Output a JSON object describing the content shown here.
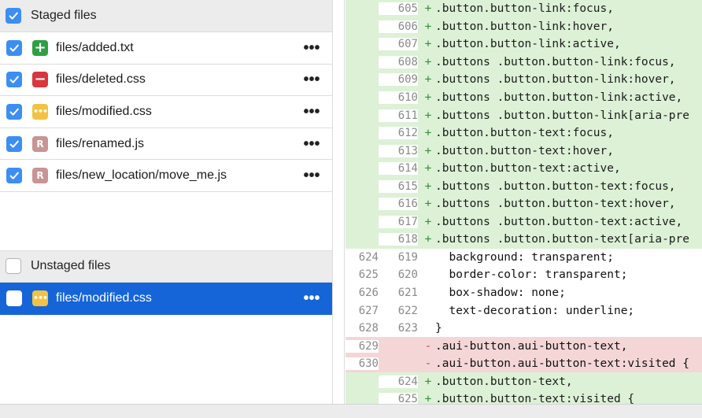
{
  "staged": {
    "header": "Staged files",
    "files": [
      {
        "name": "files/added.txt",
        "status": "added",
        "status_glyph": "+",
        "more": "•••"
      },
      {
        "name": "files/deleted.css",
        "status": "deleted",
        "status_glyph": "−",
        "more": "•••"
      },
      {
        "name": "files/modified.css",
        "status": "modified",
        "status_glyph": "•••",
        "more": "•••"
      },
      {
        "name": "files/renamed.js",
        "status": "renamed",
        "status_glyph": "R",
        "more": "•••"
      },
      {
        "name": "files/new_location/move_me.js",
        "status": "renamed",
        "status_glyph": "R",
        "more": "•••"
      }
    ]
  },
  "unstaged": {
    "header": "Unstaged files",
    "files": [
      {
        "name": "files/modified.css",
        "status": "modified",
        "status_glyph": "•••",
        "more": "•••",
        "selected": true
      }
    ]
  },
  "colors": {
    "selection": "#1565d8",
    "checkbox": "#3d8ef2",
    "added_bg": "#dcf1d6",
    "removed_bg": "#f4d6d6",
    "added_status": "#2ea043",
    "deleted_status": "#d9363e",
    "modified_status": "#f2c342",
    "renamed_status": "#c99494"
  },
  "diff": [
    {
      "old": "",
      "new": "605",
      "type": "added",
      "sign": "+",
      "code": ".button.button-link:focus,"
    },
    {
      "old": "",
      "new": "606",
      "type": "added",
      "sign": "+",
      "code": ".button.button-link:hover,"
    },
    {
      "old": "",
      "new": "607",
      "type": "added",
      "sign": "+",
      "code": ".button.button-link:active,"
    },
    {
      "old": "",
      "new": "608",
      "type": "added",
      "sign": "+",
      "code": ".buttons .button.button-link:focus,"
    },
    {
      "old": "",
      "new": "609",
      "type": "added",
      "sign": "+",
      "code": ".buttons .button.button-link:hover,"
    },
    {
      "old": "",
      "new": "610",
      "type": "added",
      "sign": "+",
      "code": ".buttons .button.button-link:active,"
    },
    {
      "old": "",
      "new": "611",
      "type": "added",
      "sign": "+",
      "code": ".buttons .button.button-link[aria-pre"
    },
    {
      "old": "",
      "new": "612",
      "type": "added",
      "sign": "+",
      "code": ".button.button-text:focus,"
    },
    {
      "old": "",
      "new": "613",
      "type": "added",
      "sign": "+",
      "code": ".button.button-text:hover,"
    },
    {
      "old": "",
      "new": "614",
      "type": "added",
      "sign": "+",
      "code": ".button.button-text:active,"
    },
    {
      "old": "",
      "new": "615",
      "type": "added",
      "sign": "+",
      "code": ".buttons .button.button-text:focus,"
    },
    {
      "old": "",
      "new": "616",
      "type": "added",
      "sign": "+",
      "code": ".buttons .button.button-text:hover,"
    },
    {
      "old": "",
      "new": "617",
      "type": "added",
      "sign": "+",
      "code": ".buttons .button.button-text:active,"
    },
    {
      "old": "",
      "new": "618",
      "type": "added",
      "sign": "+",
      "code": ".buttons .button.button-text[aria-pre"
    },
    {
      "old": "624",
      "new": "619",
      "type": "context",
      "sign": "",
      "code": "  background: transparent;"
    },
    {
      "old": "625",
      "new": "620",
      "type": "context",
      "sign": "",
      "code": "  border-color: transparent;"
    },
    {
      "old": "626",
      "new": "621",
      "type": "context",
      "sign": "",
      "code": "  box-shadow: none;"
    },
    {
      "old": "627",
      "new": "622",
      "type": "context",
      "sign": "",
      "code": "  text-decoration: underline;"
    },
    {
      "old": "628",
      "new": "623",
      "type": "context",
      "sign": "",
      "code": "}"
    },
    {
      "old": "629",
      "new": "",
      "type": "removed",
      "sign": "-",
      "code": ".aui-button.aui-button-text,"
    },
    {
      "old": "630",
      "new": "",
      "type": "removed",
      "sign": "-",
      "code": ".aui-button.aui-button-text:visited {"
    },
    {
      "old": "",
      "new": "624",
      "type": "added",
      "sign": "+",
      "code": ".button.button-text,"
    },
    {
      "old": "",
      "new": "625",
      "type": "added",
      "sign": "+",
      "code": ".button.button-text:visited {"
    }
  ]
}
